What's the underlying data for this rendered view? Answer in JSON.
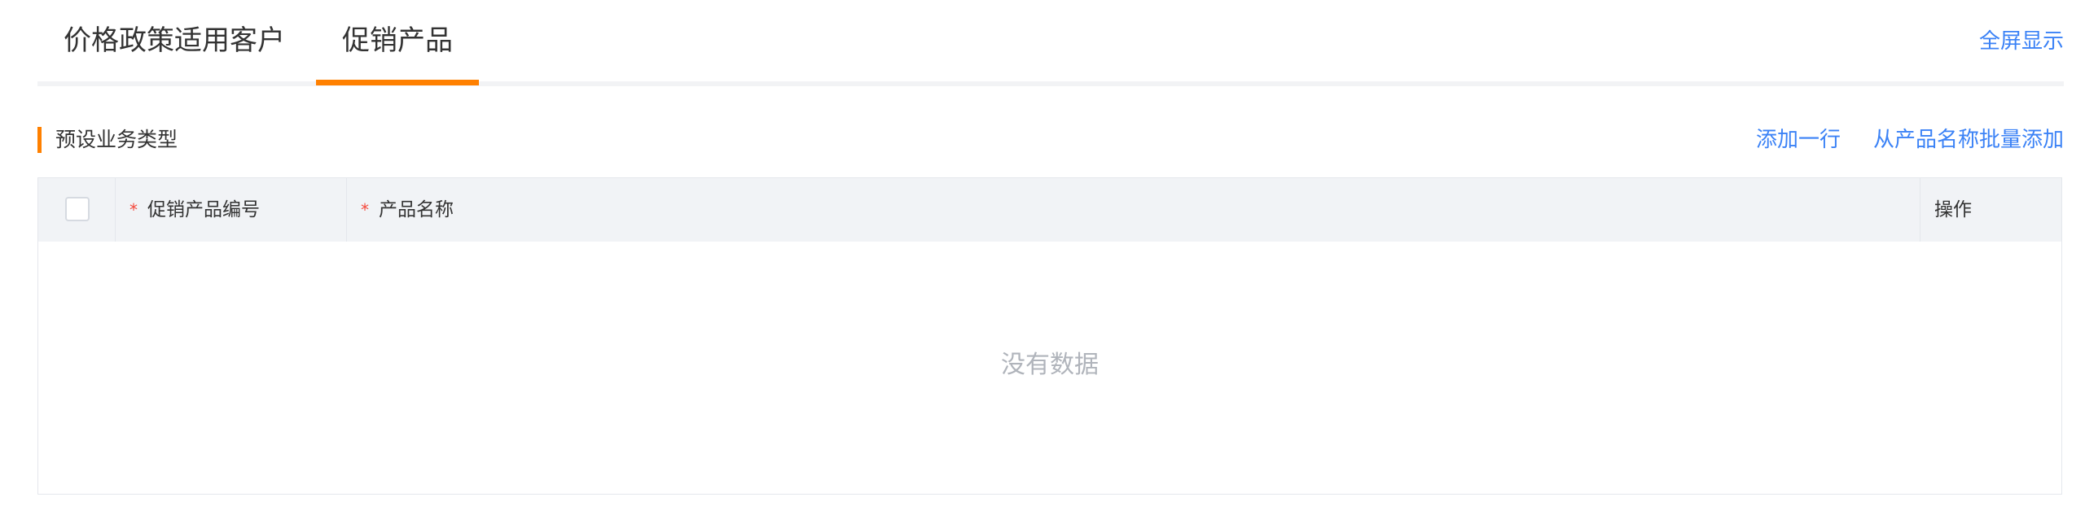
{
  "tabs": {
    "items": [
      {
        "label": "价格政策适用客户"
      },
      {
        "label": "促销产品"
      }
    ],
    "fullscreen_label": "全屏显示"
  },
  "section": {
    "title": "预设业务类型",
    "actions": {
      "add_row_label": "添加一行",
      "batch_add_label": "从产品名称批量添加"
    }
  },
  "table": {
    "columns": {
      "code": {
        "required_mark": "*",
        "label": "促销产品编号"
      },
      "name": {
        "required_mark": "*",
        "label": "产品名称"
      },
      "action": {
        "label": "操作"
      }
    },
    "empty_text": "没有数据"
  },
  "colors": {
    "accent": "#ff8000",
    "link": "#3b82f6",
    "required": "#f5483b",
    "header_bg": "#f1f3f6"
  }
}
